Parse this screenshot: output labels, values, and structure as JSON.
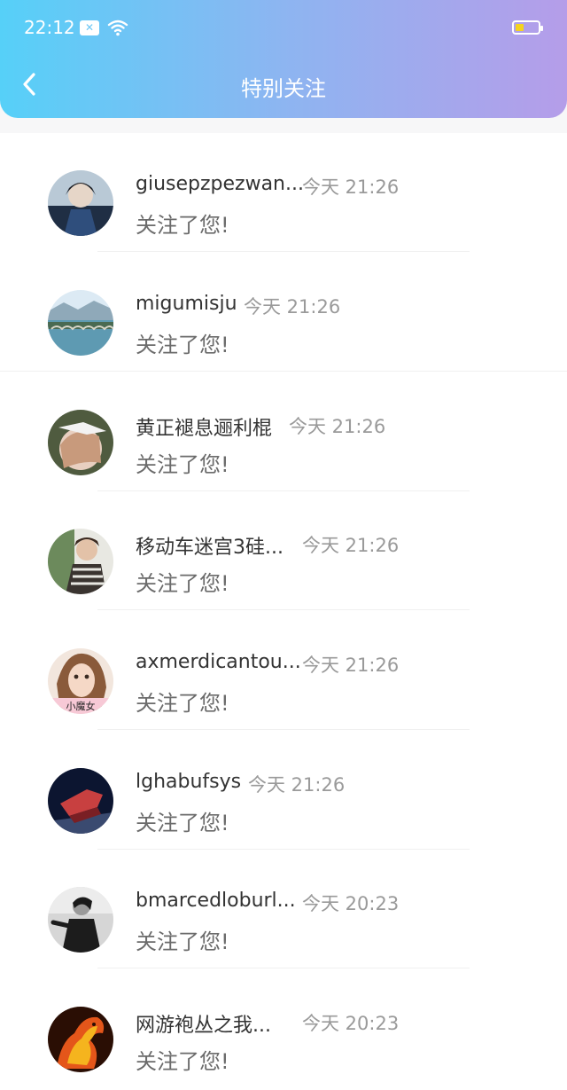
{
  "status_bar": {
    "time": "22:12",
    "notification_icon": "sim-x-icon",
    "wifi_icon": "wifi-icon",
    "battery_icon": "battery-icon",
    "battery_color": "#f4d31e"
  },
  "header": {
    "back_icon": "chevron-left-icon",
    "title": "特别关注",
    "gradient": [
      "#56d0f8",
      "#b59de9"
    ]
  },
  "items": [
    {
      "name": "giusepzpezwan...",
      "time": "今天 21:26",
      "action": "关注了您!",
      "avatar": "anime-figure"
    },
    {
      "name": "migumisju",
      "time": "今天 21:26",
      "action": "关注了您!",
      "avatar": "bridge-landscape"
    },
    {
      "name": "黄正褪息逦利棍",
      "time": "今天 21:26",
      "action": "关注了您!",
      "avatar": "girl-with-bird"
    },
    {
      "name": "移动车迷宫3硅...",
      "time": "今天 21:26",
      "action": "关注了您!",
      "avatar": "child-portrait"
    },
    {
      "name": "axmerdicantou...",
      "time": "今天 21:26",
      "action": "关注了您!",
      "avatar": "little-witch",
      "avatar_text": "小魔女"
    },
    {
      "name": "lghabufsys",
      "time": "今天 21:26",
      "action": "关注了您!",
      "avatar": "red-car-dark"
    },
    {
      "name": "bmarcedloburl...",
      "time": "今天 20:23",
      "action": "关注了您!",
      "avatar": "person-bw"
    },
    {
      "name": "网游袍丛之我...",
      "time": "今天 20:23",
      "action": "关注了您!",
      "avatar": "fire-horse"
    }
  ]
}
